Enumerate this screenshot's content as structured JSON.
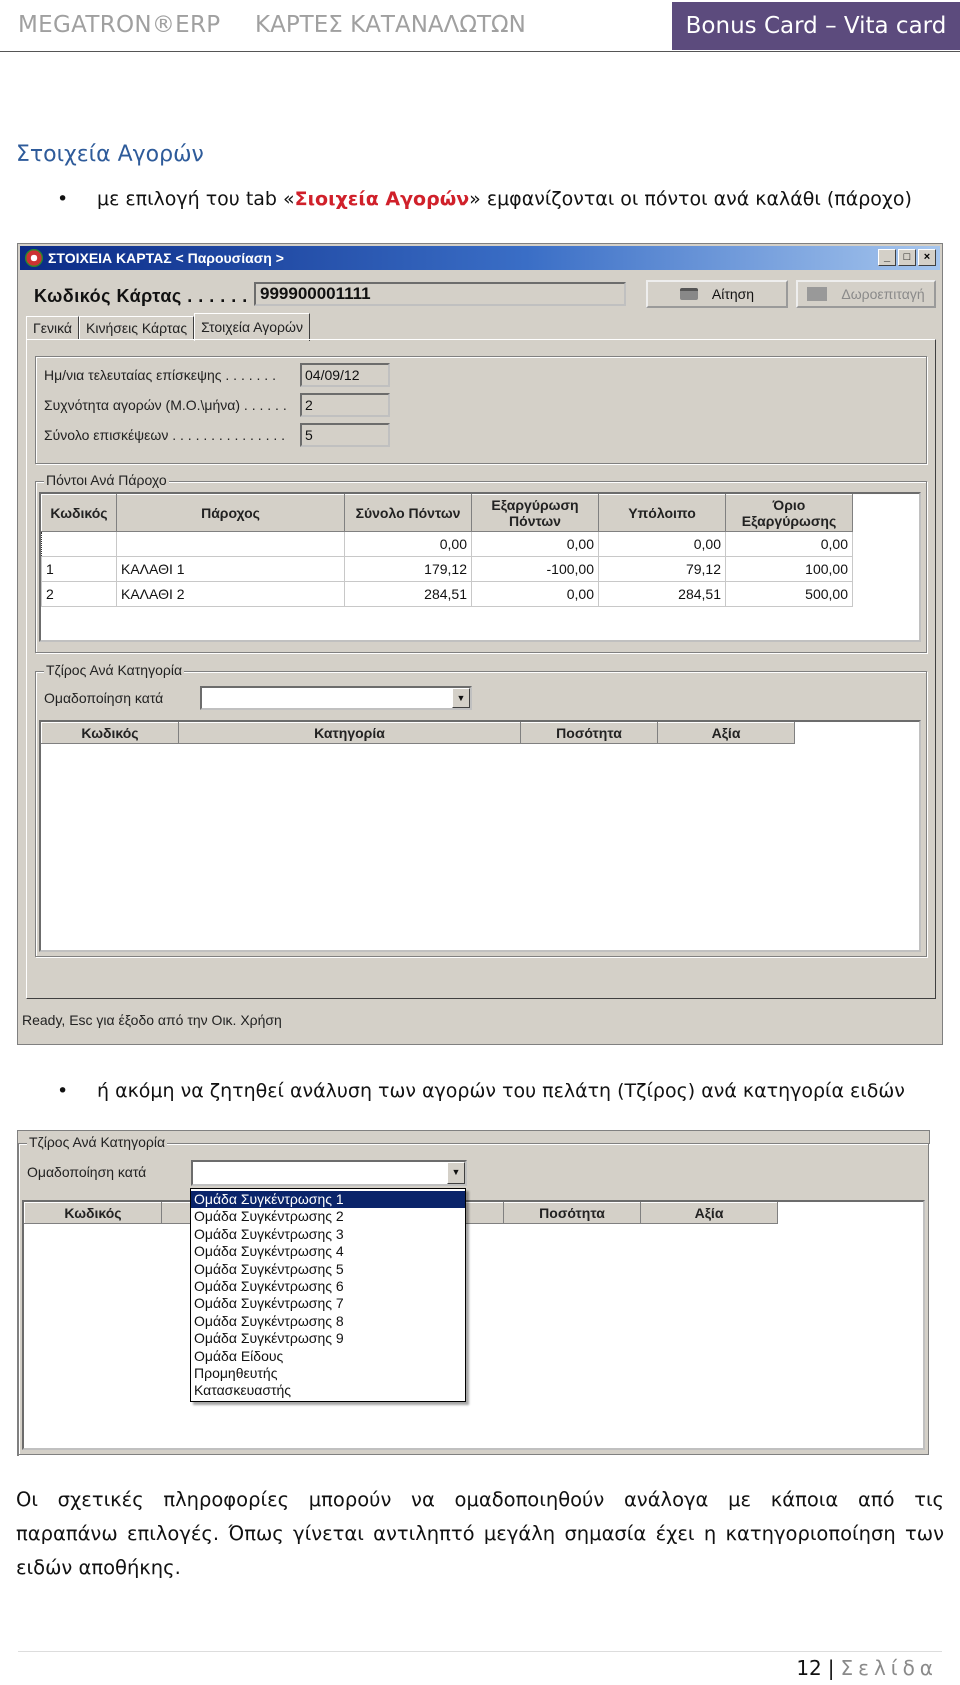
{
  "header": {
    "brand": "MEGATRON®ERP",
    "module": "ΚΑΡΤΕΣ ΚΑΤΑΝΑΛΩΤΩΝ",
    "badge": "Bonus Card – Vita card"
  },
  "section_title": "Στοιχεία Αγορών",
  "bullet1": {
    "before": "με επιλογή του tab «",
    "accent": "Σιοιχεία Αγορών",
    "after": "» εμφανίζονται οι πόντοι ανά καλάθι (πάροχο)"
  },
  "window": {
    "title": "ΣΤΟΙΧΕΙΑ ΚΑΡΤΑΣ < Παρουσίαση >",
    "code_label": "Κωδικός Κάρτας . . . . . .",
    "code_value": "999900001111",
    "request_button": "Αίτηση",
    "gift_button": "Δωροεπιταγή",
    "tabs": [
      "Γενικά",
      "Κινήσεις Κάρτας",
      "Στοιχεία Αγορών"
    ],
    "info": [
      {
        "label": "Ημ/νια τελευταίας επίσκεψης . . . . . . .",
        "value": "04/09/12"
      },
      {
        "label": "Συχνότητα αγορών (Μ.Ο.\\μήνα) . . . . . .",
        "value": "2"
      },
      {
        "label": "Σύνολο επισκέψεων . . . . . . . . . . . . . . .",
        "value": "5"
      }
    ],
    "points_group_title": "Πόντοι Ανά Πάροχο",
    "points_columns": [
      "Κωδικός",
      "Πάροχος",
      "Σύνολο Πόντων",
      "Εξαργύρωση Πόντων",
      "Υπόλοιπο",
      "Όριο Εξαργύρωσης"
    ],
    "points_rows": [
      [
        "",
        "",
        "0,00",
        "0,00",
        "0,00",
        "0,00"
      ],
      [
        "1",
        "ΚΑΛΑΘΙ 1",
        "179,12",
        "-100,00",
        "79,12",
        "100,00"
      ],
      [
        "2",
        "ΚΑΛΑΘΙ 2",
        "284,51",
        "0,00",
        "284,51",
        "500,00"
      ]
    ],
    "turnover_group_title": "Τζίρος Ανά Κατηγορία",
    "group_by_label": "Ομαδοποίηση κατά",
    "category_columns": [
      "Κωδικός",
      "Κατηγορία",
      "Ποσότητα",
      "Αξία"
    ],
    "status": "Ready, Esc για έξοδο από την Οικ. Χρήση"
  },
  "bullet2": "ή ακόμη να ζητηθεί ανάλυση των αγορών του πελάτη (Τζίρος) ανά κατηγορία ειδών",
  "window2": {
    "group_title": "Τζίρος Ανά Κατηγορία",
    "group_by_label": "Ομαδοποίηση κατά",
    "columns": [
      "Κωδικός",
      "Ποσότητα",
      "Αξία"
    ],
    "dropdown_options": [
      "Ομάδα Συγκέντρωσης 1",
      "Ομάδα Συγκέντρωσης 2",
      "Ομάδα Συγκέντρωσης 3",
      "Ομάδα Συγκέντρωσης 4",
      "Ομάδα Συγκέντρωσης 5",
      "Ομάδα Συγκέντρωσης 6",
      "Ομάδα Συγκέντρωσης 7",
      "Ομάδα Συγκέντρωσης 8",
      "Ομάδα Συγκέντρωσης 9",
      "Ομάδα Είδους",
      "Προμηθευτής",
      "Κατασκευαστής"
    ],
    "selected_option": "Ομάδα Συγκέντρωσης 1"
  },
  "paragraph": {
    "line1": "Οι σχετικές πληροφορίες μπορούν να ομαδοποιηθούν ανάλογα με κάποια από τις",
    "rest": "παραπάνω επιλογές. Όπως γίνεται αντιληπτό μεγάλη σημασία έχει η κατηγοριοποίηση των ειδών αποθήκης."
  },
  "footer": {
    "page_number": "12",
    "separator": "|",
    "page_word": "Σελίδα"
  }
}
